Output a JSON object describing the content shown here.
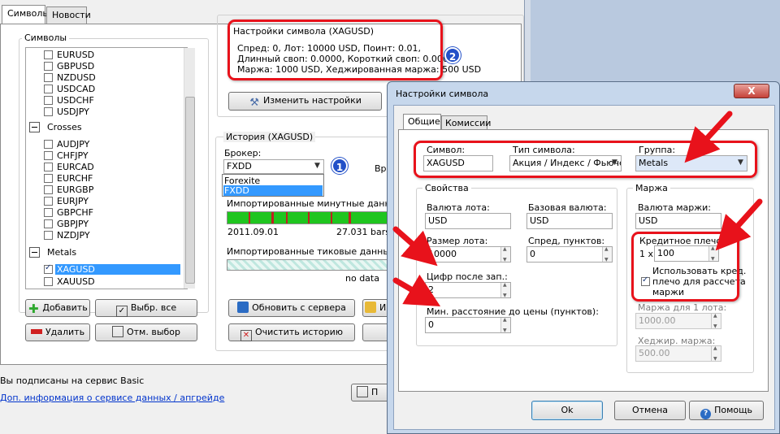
{
  "main": {
    "tabs": [
      "Символы",
      "Новости"
    ],
    "symbols_group_title": "Символы",
    "symbols": [
      {
        "name": "EURUSD",
        "checked": false
      },
      {
        "name": "GBPUSD",
        "checked": false
      },
      {
        "name": "NZDUSD",
        "checked": false
      },
      {
        "name": "USDCAD",
        "checked": false
      },
      {
        "name": "USDCHF",
        "checked": false
      },
      {
        "name": "USDJPY",
        "checked": false
      }
    ],
    "crosses_group": "Crosses",
    "crosses": [
      {
        "name": "AUDJPY"
      },
      {
        "name": "CHFJPY"
      },
      {
        "name": "EURCAD"
      },
      {
        "name": "EURCHF"
      },
      {
        "name": "EURGBP"
      },
      {
        "name": "EURJPY"
      },
      {
        "name": "GBPCHF"
      },
      {
        "name": "GBPJPY"
      },
      {
        "name": "NZDJPY"
      }
    ],
    "metals_group": "Metals",
    "metals": [
      {
        "name": "XAGUSD",
        "checked": true,
        "selected": true
      },
      {
        "name": "XAUUSD",
        "checked": false
      }
    ],
    "buttons": {
      "add": "Добавить",
      "select_all": "Выбр. все",
      "delete": "Удалить",
      "deselect": "Отм. выбор",
      "change_settings": "Изменить настройки",
      "update_server": "Обновить с сервера",
      "import_partial": "И",
      "clear_history": "Очистить историю",
      "partial_right": "П"
    },
    "symbol_settings": {
      "title": "Настройки символа (XAGUSD)",
      "line1": "Спред: 0, Лот: 10000 USD, Поинт: 0.01,",
      "line2": "Длинный своп: 0.0000, Короткий своп: 0.0000,",
      "line3": "Маржа: 1000 USD, Хеджированная маржа: 500 USD",
      "badge": "2"
    },
    "history": {
      "title": "История (XAGUSD)",
      "broker_label": "Брокер:",
      "broker_value": "FXDD",
      "broker_options": [
        "Forexite",
        "FXDD"
      ],
      "partial_label": "Вре",
      "badge": "1",
      "minute_label": "Импортированные минутные данные:",
      "minute_date": "2011.09.01",
      "minute_bars": "27.031 bars",
      "tick_label": "Импортированные тиковые данные (опц",
      "tick_status": "no data",
      "minute_fill_color": "#1fc51f",
      "minute_gap_color": "#c02020"
    },
    "status": {
      "subscribed": "Вы подписаны на сервис Basic",
      "info_link": "Доп. информация о сервисе данных / апгрейде"
    }
  },
  "dialog": {
    "title": "Настройки символа",
    "close": "X",
    "tabs": [
      "Общие",
      "Комиссии"
    ],
    "symbol_label": "Символ:",
    "symbol_value": "XAGUSD",
    "type_label": "Тип символа:",
    "type_value": "Акция / Индекс / Фьюче",
    "group_label": "Группа:",
    "group_value": "Metals",
    "props_title": "Свойства",
    "lot_currency_label": "Валюта лота:",
    "lot_currency_value": "USD",
    "base_currency_label": "Базовая валюта:",
    "base_currency_value": "USD",
    "lot_size_label": "Размер лота:",
    "lot_size_value": "10000",
    "spread_label": "Спред, пунктов:",
    "spread_value": "0",
    "digits_label": "Цифр после зап.:",
    "digits_value": "2",
    "min_dist_label": "Мин. расстояние до цены (пунктов):",
    "min_dist_value": "0",
    "margin_title": "Маржа",
    "margin_currency_label": "Валюта маржи:",
    "margin_currency_value": "USD",
    "leverage_label": "Кредитное плечо:",
    "leverage_prefix": "1 x",
    "leverage_value": "100",
    "use_leverage_lines": [
      "Использовать кред.",
      "плечо для рассчета",
      "маржи"
    ],
    "use_leverage_checked": true,
    "margin_per_lot_label": "Маржа для 1 лота:",
    "margin_per_lot_value": "1000.00",
    "hedged_margin_label": "Хеджир. маржа:",
    "hedged_margin_value": "500.00",
    "ok": "Ok",
    "cancel": "Отмена",
    "help": "Помощь"
  },
  "colors": {
    "highlight_red": "#e8121b",
    "badge_blue": "#2250c8",
    "selection_blue": "#3399ff"
  }
}
